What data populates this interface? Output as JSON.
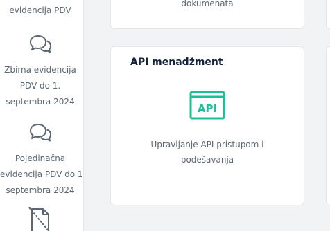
{
  "sidebar": {
    "items": [
      {
        "label_lines": [
          "evidencija PDV"
        ],
        "icon": "chat-bubbles-icon"
      },
      {
        "label_lines": [
          "Zbirna evidencija",
          "PDV do 1.",
          "septembra 2024"
        ],
        "icon": "chat-bubbles-icon"
      },
      {
        "label_lines": [
          "Pojedinačna",
          "evidencija PDV do 1.",
          "septembra 2024"
        ],
        "icon": "chat-bubbles-icon"
      },
      {
        "icon": "document-slash-icon"
      }
    ]
  },
  "cards": {
    "top": {
      "text": "dokumenata"
    },
    "api": {
      "title": "API menadžment",
      "icon_label": "API",
      "description_lines": [
        "Upravljanje API pristupom i",
        "podešavanja"
      ]
    }
  },
  "colors": {
    "accent": "#1dbf98",
    "title": "#13233d",
    "text": "#5b6675",
    "background": "#f2f3f5"
  }
}
